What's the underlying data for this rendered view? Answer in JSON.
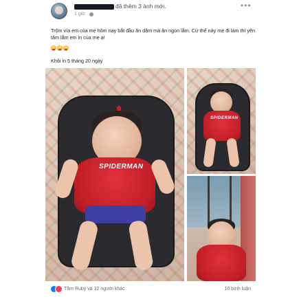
{
  "post": {
    "author_action": "đã thêm 3 ảnh mới.",
    "timestamp": "1 giờ",
    "privacy_icon": "globe-icon",
    "more_icon": "more-icon",
    "caption": "Trộm vía em của mẹ hôm nay bắt đầu ăn dặm mà ăn ngon lắm. Cứ thế này mẹ đi làm thì yên tâm lắm em ỉn của mẹ ạ!",
    "emoji": [
      "smile-emoji",
      "smile-emoji",
      "smile-emoji"
    ],
    "subcaption": "Khôi ỉn 5 tháng 20 ngày",
    "photos": [
      {
        "name": "photo-main",
        "shirt_text": "SPIDERMAN"
      },
      {
        "name": "photo-top-right",
        "shirt_text": "SPIDERMAN"
      },
      {
        "name": "photo-bottom-right",
        "shirt_text": ""
      }
    ]
  },
  "footer": {
    "reactions": [
      "like-icon",
      "love-icon"
    ],
    "reactors_text": "Tâm Ruby và 32 người khác",
    "comments_text": "10 bình luận"
  },
  "colors": {
    "like": "#1877f2",
    "love": "#f33e58",
    "shirt_red": "#c21f28"
  }
}
